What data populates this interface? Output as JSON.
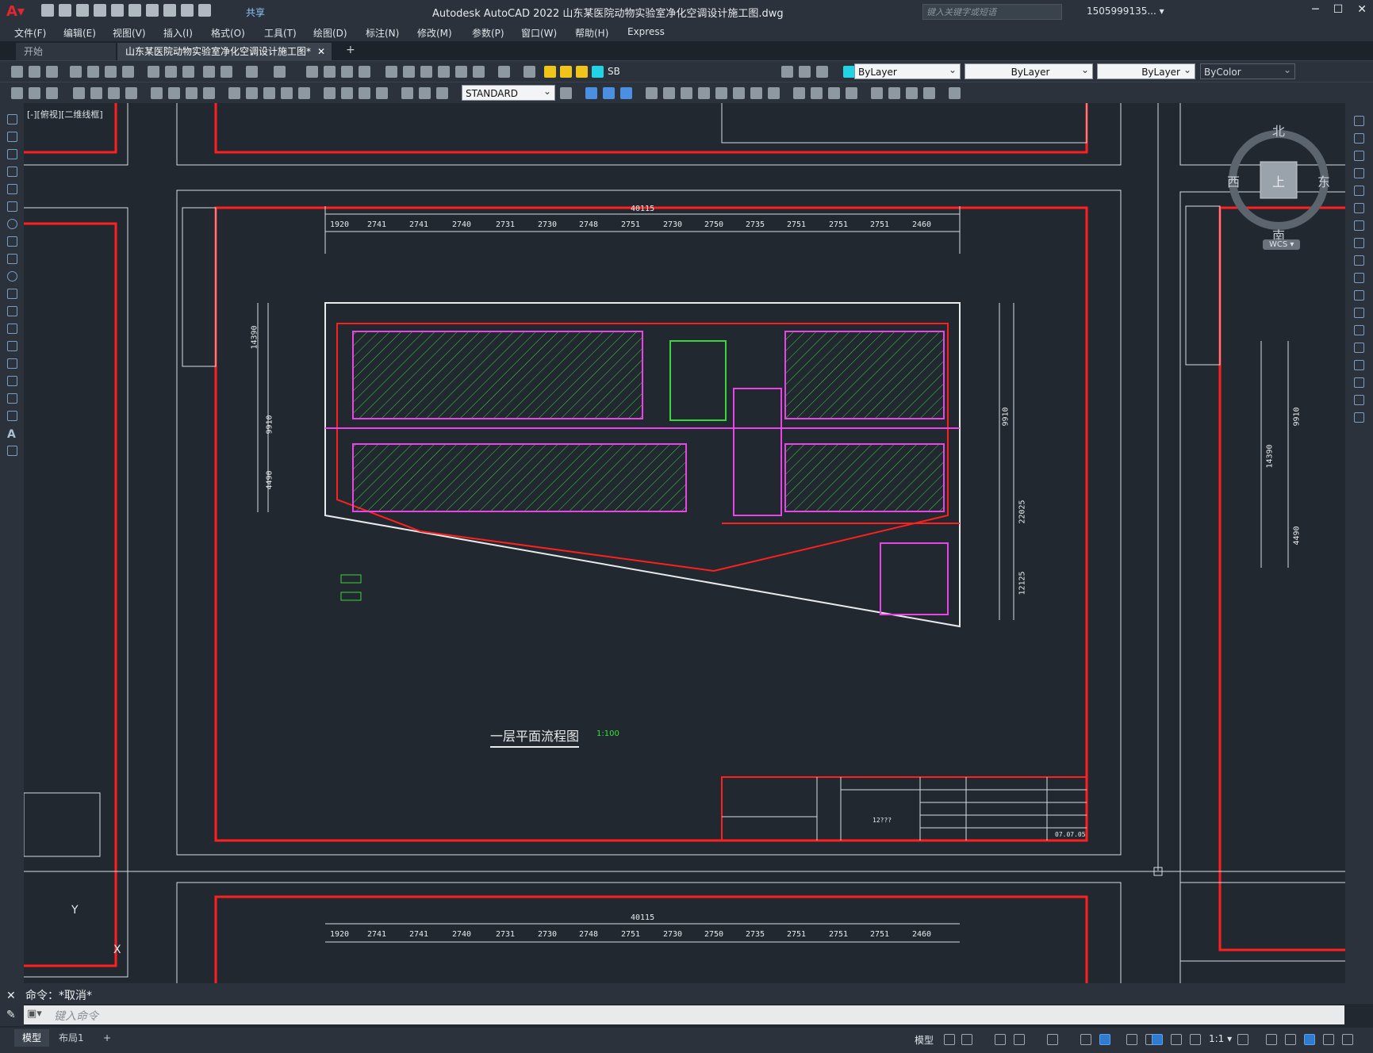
{
  "app": {
    "title": "Autodesk AutoCAD 2022    山东某医院动物实验室净化空调设计施工图.dwg",
    "share_label": "共享",
    "search_placeholder": "键入关键字或短语",
    "user": "1505999135... ▾"
  },
  "menu": [
    "文件(F)",
    "编辑(E)",
    "视图(V)",
    "插入(I)",
    "格式(O)",
    "工具(T)",
    "绘图(D)",
    "标注(N)",
    "修改(M)",
    "参数(P)",
    "窗口(W)",
    "帮助(H)",
    "Express"
  ],
  "tabs": {
    "start": "开始",
    "active": "山东某医院动物实验室净化空调设计施工图*",
    "close": "✕",
    "add": "+"
  },
  "toolbar": {
    "layer": "SB",
    "color": "ByLayer",
    "linetype": "ByLayer",
    "lineweight": "ByLayer",
    "plotstyle": "ByColor",
    "textstyle": "STANDARD"
  },
  "viewport": {
    "label": "[-][俯视][二维线框]",
    "cube": {
      "north": "北",
      "south": "南",
      "east": "东",
      "west": "西",
      "top": "上",
      "wcs": "WCS ▾"
    },
    "ucs": {
      "x": "X",
      "y": "Y"
    }
  },
  "drawing": {
    "title": "一层平面流程图",
    "scale": "1:100",
    "overall_dim": "40115",
    "top_dims": [
      "1920",
      "2741",
      "2741",
      "2740",
      "2731",
      "2730",
      "2748",
      "2751",
      "2730",
      "2750",
      "2735",
      "2751",
      "2751",
      "2751",
      "2460"
    ],
    "left_dims": [
      "14390",
      "9910",
      "4490"
    ],
    "right_dims": [
      "9910",
      "22025",
      "12125"
    ],
    "right_frame_dims": [
      "14390",
      "9910",
      "4490"
    ],
    "bottom_overall_dim": "40115",
    "bottom_dims": [
      "1920",
      "2741",
      "2741",
      "2740",
      "2731",
      "2730",
      "2748",
      "2751",
      "2730",
      "2750",
      "2735",
      "2751",
      "2751",
      "2751",
      "2460"
    ],
    "title_block_number": "12???",
    "title_block_date": "07.07.05"
  },
  "command": {
    "history": "命令：*取消*",
    "placeholder": "键入命令"
  },
  "status": {
    "model_tab": "模型",
    "layout_tab": "布局1",
    "add": "+",
    "model_label": "模型",
    "scale": "1:1 ▾"
  },
  "colors": {
    "accent": "#2f7bd0",
    "frame_red": "#ff1f1f",
    "hatch_green": "#3bd43b",
    "duct_magenta": "#e844e8",
    "background": "#212830"
  }
}
